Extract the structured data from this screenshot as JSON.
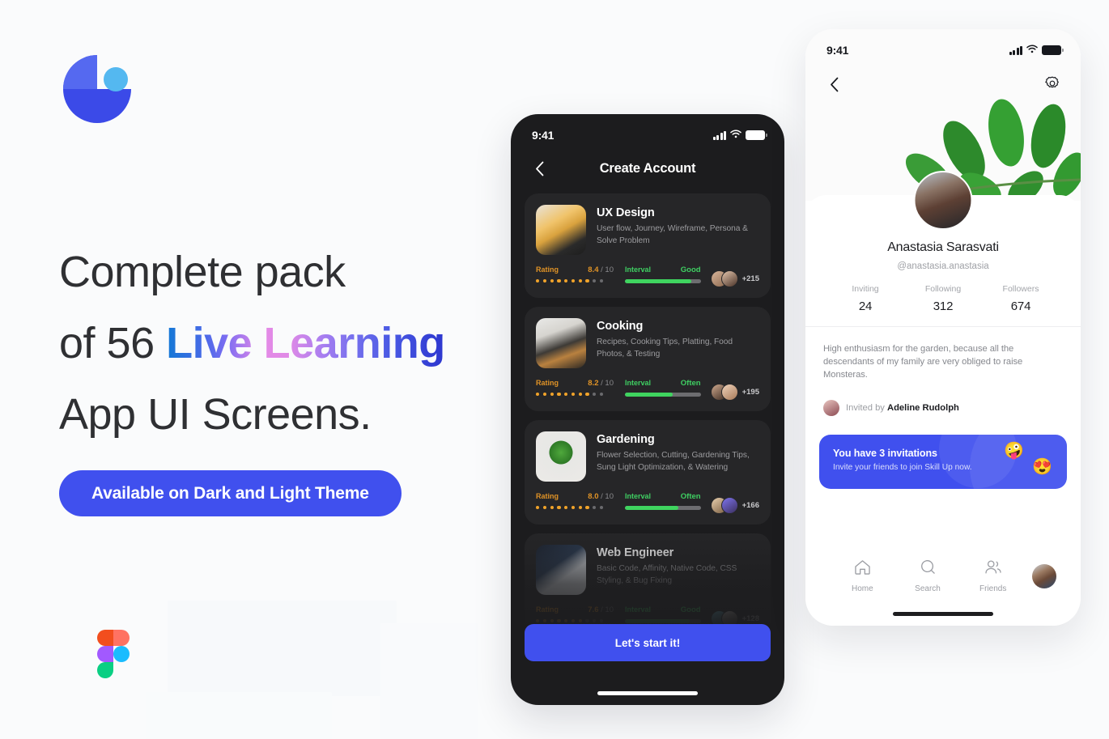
{
  "brand": {
    "logo_name": "pie-chart-logo",
    "figma_logo": "figma-logo"
  },
  "hero": {
    "line1": "Complete pack",
    "line2_prefix": "of 56 ",
    "line2_accent": "Live Learning",
    "line3": "App UI Screens.",
    "cta_label": "Available on Dark and Light Theme",
    "accent_color": "#4050ee"
  },
  "dark_phone": {
    "status": {
      "time": "9:41",
      "signal": "cellular-signal-icon",
      "wifi": "wifi-icon",
      "battery": "battery-icon"
    },
    "nav": {
      "back": "chevron-left-icon",
      "title": "Create Account"
    },
    "primary_button": "Let's start it!",
    "cards": [
      {
        "title": "UX Design",
        "desc": "User flow, Journey, Wireframe, Persona & Solve Problem",
        "rating_label": "Rating",
        "rating_value": "8.4",
        "rating_denom": "/ 10",
        "rating_dots_filled": 8,
        "rating_dots_total": 10,
        "interval_label": "Interval",
        "interval_value": "Good",
        "interval_percent": 88,
        "people_count": "+215"
      },
      {
        "title": "Cooking",
        "desc": "Recipes, Cooking Tips, Platting, Food Photos, & Testing",
        "rating_label": "Rating",
        "rating_value": "8.2",
        "rating_denom": "/ 10",
        "rating_dots_filled": 8,
        "rating_dots_total": 10,
        "interval_label": "Interval",
        "interval_value": "Often",
        "interval_percent": 63,
        "people_count": "+195"
      },
      {
        "title": "Gardening",
        "desc": "Flower Selection, Cutting, Gardening Tips, Sung Light Optimization, & Watering",
        "rating_label": "Rating",
        "rating_value": "8.0",
        "rating_denom": "/ 10",
        "rating_dots_filled": 8,
        "rating_dots_total": 10,
        "interval_label": "Interval",
        "interval_value": "Often",
        "interval_percent": 70,
        "people_count": "+166"
      },
      {
        "title": "Web Engineer",
        "desc": "Basic Code, Affinity, Native Code, CSS Styling, & Bug Fixing",
        "rating_label": "Rating",
        "rating_value": "7.6",
        "rating_denom": "/ 10",
        "rating_dots_filled": 7,
        "rating_dots_total": 10,
        "interval_label": "Interval",
        "interval_value": "Good",
        "interval_percent": 85,
        "people_count": "+128"
      }
    ]
  },
  "light_phone": {
    "status": {
      "time": "9:41",
      "signal": "cellular-signal-icon",
      "wifi": "wifi-icon",
      "battery": "battery-icon"
    },
    "nav": {
      "back": "chevron-left-icon",
      "settings": "gear-icon"
    },
    "profile": {
      "name": "Anastasia Sarasvati",
      "handle": "@anastasia.anastasia",
      "stats": [
        {
          "label": "Inviting",
          "value": "24"
        },
        {
          "label": "Following",
          "value": "312"
        },
        {
          "label": "Followers",
          "value": "674"
        }
      ],
      "bio": "High enthusiasm for the garden, because all the descendants of my family are very obliged to raise Monsteras.",
      "invited_by_prefix": "Invited by ",
      "invited_by_name": "Adeline Rudolph"
    },
    "invite_banner": {
      "title": "You have 3 invitations",
      "subtitle": "Invite your friends to join Skill Up now.",
      "emoji_left": "🤪",
      "emoji_right": "😍",
      "background": "#4050ee"
    },
    "tabs": [
      {
        "label": "Home",
        "icon": "home-icon"
      },
      {
        "label": "Search",
        "icon": "search-icon"
      },
      {
        "label": "Friends",
        "icon": "friends-icon"
      }
    ],
    "profile_tab_icon": "profile-avatar"
  }
}
